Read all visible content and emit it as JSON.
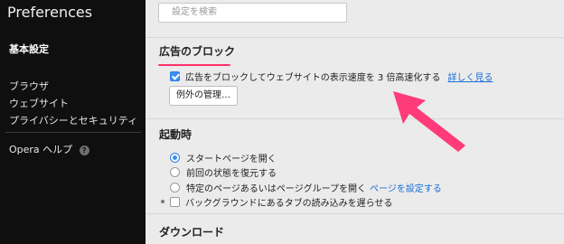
{
  "sidebar": {
    "title": "Preferences",
    "items": [
      {
        "label": "基本設定",
        "active": true
      },
      {
        "label": "ブラウザ"
      },
      {
        "label": "ウェブサイト"
      },
      {
        "label": "プライバシーとセキュリティ"
      }
    ],
    "help_label": "Opera ヘルプ",
    "help_icon": "question-circle-icon"
  },
  "search": {
    "placeholder": "設定を検索",
    "icon": "none"
  },
  "ad_block": {
    "title": "広告のブロック",
    "checkbox_label": "広告をブロックしてウェブサイトの表示速度を 3 倍高速化する",
    "checkbox_checked": true,
    "learn_more": "詳しく見る",
    "exceptions_button": "例外の管理…"
  },
  "startup": {
    "title": "起動時",
    "options": [
      {
        "label": "スタートページを開く",
        "selected": true
      },
      {
        "label": "前回の状態を復元する",
        "selected": false
      },
      {
        "label": "特定のページあるいはページグループを開く",
        "selected": false,
        "link": "ページを設定する"
      }
    ],
    "background_tabs_label": "バックグラウンドにあるタブの読み込みを遅らせる",
    "background_tabs_checked": false
  },
  "downloads": {
    "title": "ダウンロード"
  },
  "colors": {
    "accent": "#ff3369",
    "link": "#1a6fd6",
    "checkbox": "#3a8ff0",
    "sidebar_bg": "#0f0f0f"
  }
}
